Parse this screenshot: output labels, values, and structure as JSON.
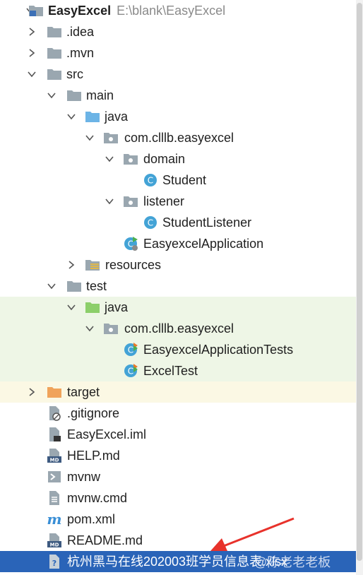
{
  "project": {
    "name": "EasyExcel",
    "path": "E:\\blank\\EasyExcel"
  },
  "rows": {
    "idea": ".idea",
    "mvn": ".mvn",
    "src": "src",
    "main": "main",
    "main_java": "java",
    "main_pkg": "com.clllb.easyexcel",
    "domain": "domain",
    "student": "Student",
    "listener": "listener",
    "student_listener": "StudentListener",
    "app": "EasyexcelApplication",
    "resources": "resources",
    "test": "test",
    "test_java": "java",
    "test_pkg": "com.clllb.easyexcel",
    "app_tests": "EasyexcelApplicationTests",
    "excel_test": "ExcelTest",
    "target": "target",
    "gitignore": ".gitignore",
    "iml": "EasyExcel.iml",
    "help": "HELP.md",
    "mvnw": "mvnw",
    "mvnw_cmd": "mvnw.cmd",
    "pom": "pom.xml",
    "readme": "README.md",
    "xlsx": "杭州黑马在线202003班学员信息表.xlsx"
  },
  "watermark": "@陈老老老板",
  "colors": {
    "selection": "#2a64b8",
    "test_bg": "#eef6e6",
    "excluded_bg": "#fbf8e4",
    "folder": "#9aa7b0",
    "java_source": "#6cb4e6",
    "test_source": "#8ccf6a",
    "excluded": "#f0a35b",
    "class": "#43a3d6",
    "annotation_arrow": "#e8322b"
  }
}
